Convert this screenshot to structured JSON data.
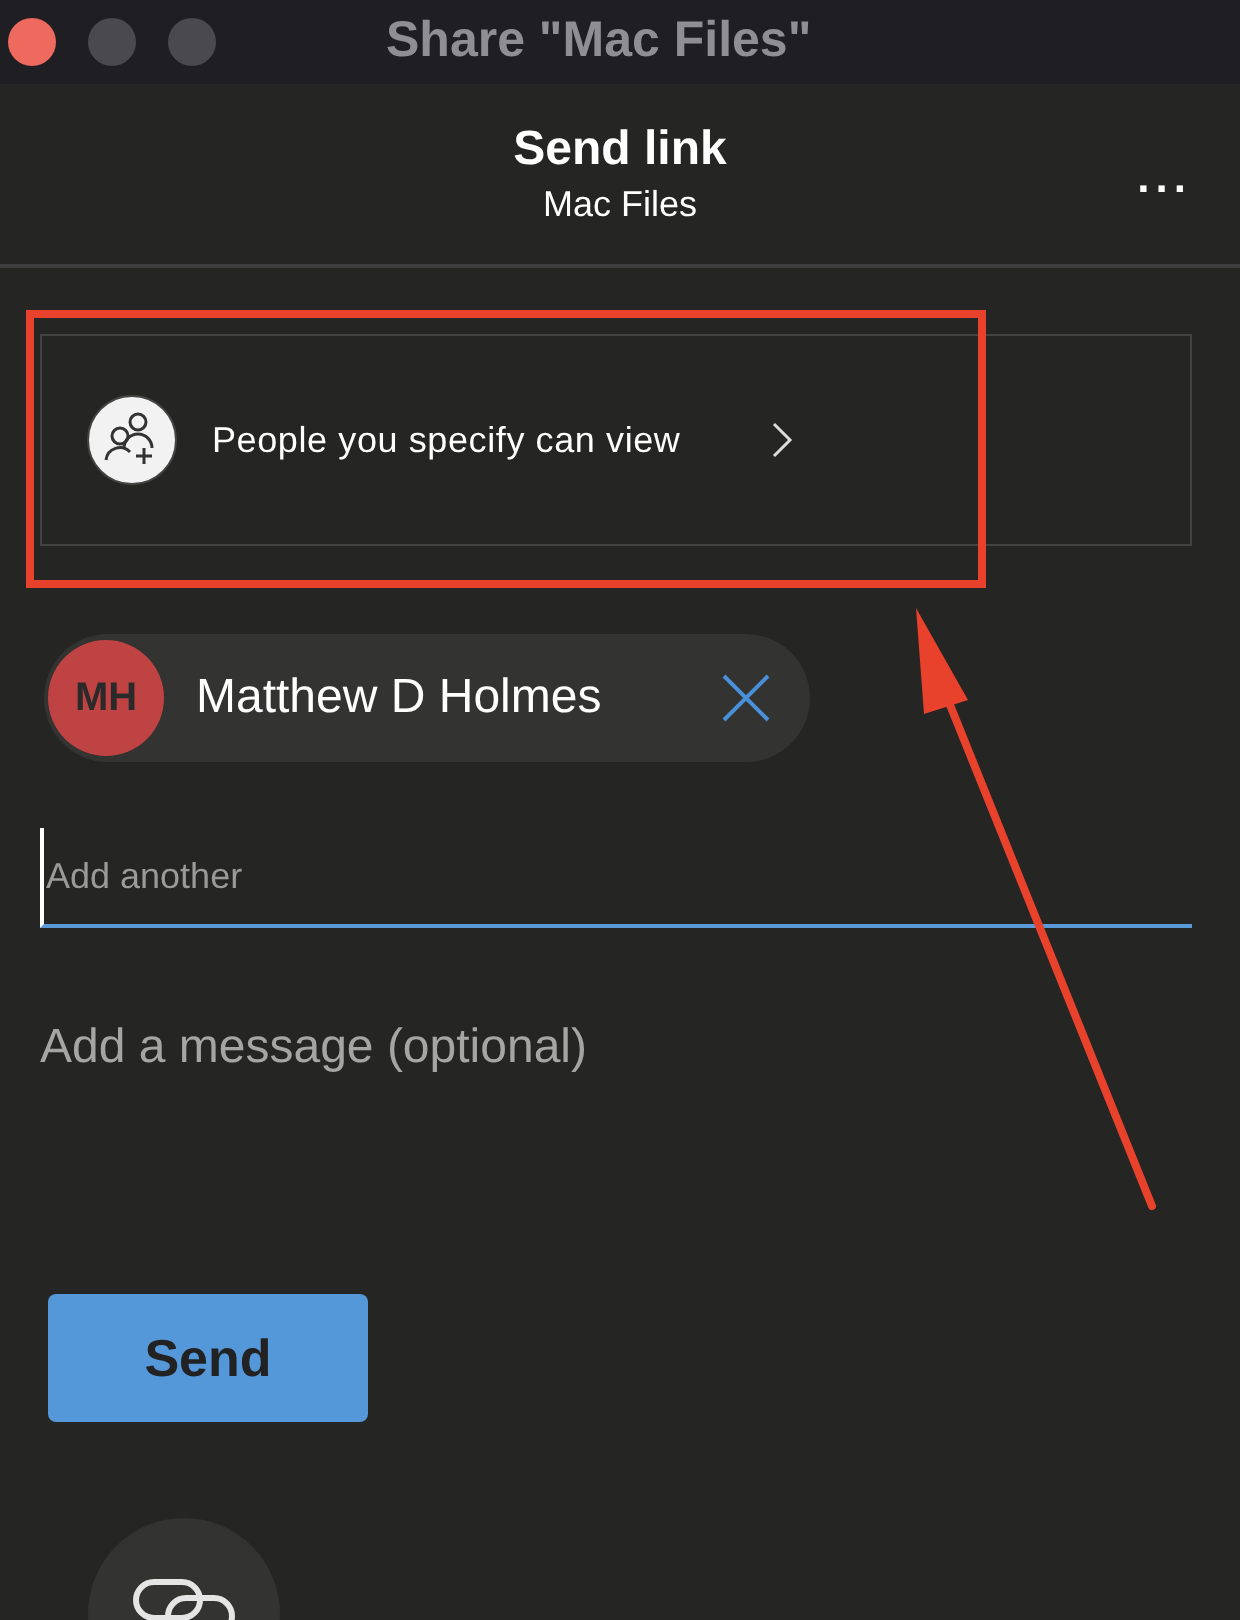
{
  "window": {
    "title": "Share \"Mac Files\""
  },
  "header": {
    "title": "Send link",
    "subtitle": "Mac Files",
    "more": "..."
  },
  "permission": {
    "label": "People you specify can view"
  },
  "recipients": [
    {
      "initials": "MH",
      "name": "Matthew D Holmes"
    }
  ],
  "add_field": {
    "placeholder": "Add another"
  },
  "message_field": {
    "placeholder": "Add a message (optional)"
  },
  "send_button": "Send"
}
